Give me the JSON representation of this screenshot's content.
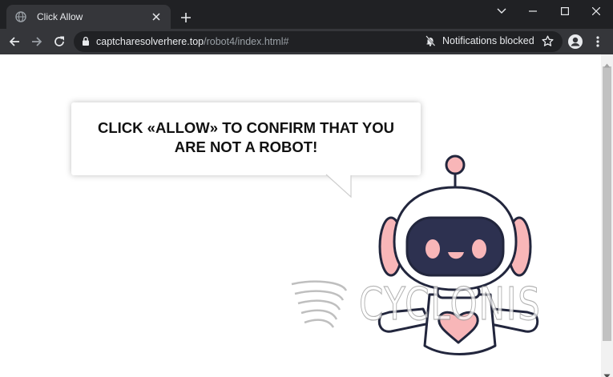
{
  "tab": {
    "title": "Click Allow"
  },
  "address_bar": {
    "host": "captcharesolverhere.top",
    "path": "/robot4/index.html#",
    "notifications_label": "Notifications blocked"
  },
  "page": {
    "message": "CLICK «ALLOW» TO CONFIRM THAT YOU ARE NOT A ROBOT!",
    "watermark": "CYCLONIS"
  },
  "colors": {
    "robot_outline": "#22263d",
    "robot_pink": "#f8b6b8",
    "robot_visor": "#2d3150"
  }
}
